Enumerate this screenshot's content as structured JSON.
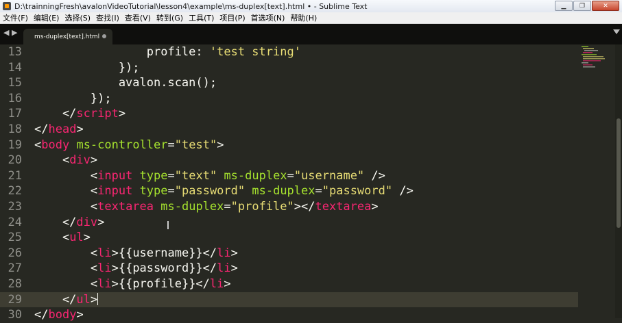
{
  "window": {
    "title": "D:\\trainningFresh\\avalonVideoTutorial\\lesson4\\example\\ms-duplex[text].html • - Sublime Text",
    "minimize_glyph": "▁",
    "maximize_glyph": "❐",
    "close_glyph": "✕"
  },
  "menu": [
    "文件(F)",
    "编辑(E)",
    "选择(S)",
    "查找(I)",
    "查看(V)",
    "转到(G)",
    "工具(T)",
    "项目(P)",
    "首选项(N)",
    "帮助(H)"
  ],
  "tabs": {
    "prev_arrow": "◀",
    "next_arrow": "▶",
    "active": {
      "label": "ms-duplex[text].html",
      "modified": true
    }
  },
  "editor": {
    "theme_colors": {
      "background": "#272822",
      "tag": "#f92672",
      "attribute": "#a6e22e",
      "string": "#e6db74",
      "text": "#f8f8f2",
      "line_number": "#90908a",
      "current_line": "#3e3d32"
    },
    "current_line": 29,
    "lines": [
      {
        "num": "13",
        "tokens": [
          {
            "c": "p",
            "t": "                profile: "
          },
          {
            "c": "s",
            "t": "'test string'"
          }
        ]
      },
      {
        "num": "14",
        "tokens": [
          {
            "c": "p",
            "t": "            });"
          }
        ]
      },
      {
        "num": "15",
        "tokens": [
          {
            "c": "p",
            "t": "            avalon.scan();"
          }
        ]
      },
      {
        "num": "16",
        "tokens": [
          {
            "c": "p",
            "t": "        });"
          }
        ]
      },
      {
        "num": "17",
        "tokens": [
          {
            "c": "p",
            "t": "    </"
          },
          {
            "c": "t",
            "t": "script"
          },
          {
            "c": "p",
            "t": ">"
          }
        ]
      },
      {
        "num": "18",
        "tokens": [
          {
            "c": "p",
            "t": "</"
          },
          {
            "c": "t",
            "t": "head"
          },
          {
            "c": "p",
            "t": ">"
          }
        ]
      },
      {
        "num": "19",
        "tokens": [
          {
            "c": "p",
            "t": "<"
          },
          {
            "c": "t",
            "t": "body"
          },
          {
            "c": "p",
            "t": " "
          },
          {
            "c": "a",
            "t": "ms-controller"
          },
          {
            "c": "p",
            "t": "="
          },
          {
            "c": "s",
            "t": "\"test\""
          },
          {
            "c": "p",
            "t": ">"
          }
        ]
      },
      {
        "num": "20",
        "tokens": [
          {
            "c": "p",
            "t": "    <"
          },
          {
            "c": "t",
            "t": "div"
          },
          {
            "c": "p",
            "t": ">"
          }
        ]
      },
      {
        "num": "21",
        "tokens": [
          {
            "c": "p",
            "t": "        <"
          },
          {
            "c": "t",
            "t": "input"
          },
          {
            "c": "p",
            "t": " "
          },
          {
            "c": "a",
            "t": "type"
          },
          {
            "c": "p",
            "t": "="
          },
          {
            "c": "s",
            "t": "\"text\""
          },
          {
            "c": "p",
            "t": " "
          },
          {
            "c": "a",
            "t": "ms-duplex"
          },
          {
            "c": "p",
            "t": "="
          },
          {
            "c": "s",
            "t": "\"username\""
          },
          {
            "c": "p",
            "t": " />"
          }
        ]
      },
      {
        "num": "22",
        "tokens": [
          {
            "c": "p",
            "t": "        <"
          },
          {
            "c": "t",
            "t": "input"
          },
          {
            "c": "p",
            "t": " "
          },
          {
            "c": "a",
            "t": "type"
          },
          {
            "c": "p",
            "t": "="
          },
          {
            "c": "s",
            "t": "\"password\""
          },
          {
            "c": "p",
            "t": " "
          },
          {
            "c": "a",
            "t": "ms-duplex"
          },
          {
            "c": "p",
            "t": "="
          },
          {
            "c": "s",
            "t": "\"password\""
          },
          {
            "c": "p",
            "t": " />"
          }
        ]
      },
      {
        "num": "23",
        "tokens": [
          {
            "c": "p",
            "t": "        <"
          },
          {
            "c": "t",
            "t": "textarea"
          },
          {
            "c": "p",
            "t": " "
          },
          {
            "c": "a",
            "t": "ms-duplex"
          },
          {
            "c": "p",
            "t": "="
          },
          {
            "c": "s",
            "t": "\"profile\""
          },
          {
            "c": "p",
            "t": "></"
          },
          {
            "c": "t",
            "t": "textarea"
          },
          {
            "c": "p",
            "t": ">"
          }
        ]
      },
      {
        "num": "24",
        "tokens": [
          {
            "c": "p",
            "t": "    </"
          },
          {
            "c": "t",
            "t": "div"
          },
          {
            "c": "p",
            "t": ">"
          }
        ]
      },
      {
        "num": "25",
        "tokens": [
          {
            "c": "p",
            "t": "    <"
          },
          {
            "c": "t",
            "t": "ul"
          },
          {
            "c": "p",
            "t": ">"
          }
        ]
      },
      {
        "num": "26",
        "tokens": [
          {
            "c": "p",
            "t": "        <"
          },
          {
            "c": "t",
            "t": "li"
          },
          {
            "c": "p",
            "t": ">{{username}}</"
          },
          {
            "c": "t",
            "t": "li"
          },
          {
            "c": "p",
            "t": ">"
          }
        ]
      },
      {
        "num": "27",
        "tokens": [
          {
            "c": "p",
            "t": "        <"
          },
          {
            "c": "t",
            "t": "li"
          },
          {
            "c": "p",
            "t": ">{{password}}</"
          },
          {
            "c": "t",
            "t": "li"
          },
          {
            "c": "p",
            "t": ">"
          }
        ]
      },
      {
        "num": "28",
        "tokens": [
          {
            "c": "p",
            "t": "        <"
          },
          {
            "c": "t",
            "t": "li"
          },
          {
            "c": "p",
            "t": ">{{profile}}</"
          },
          {
            "c": "t",
            "t": "li"
          },
          {
            "c": "p",
            "t": ">"
          }
        ]
      },
      {
        "num": "29",
        "tokens": [
          {
            "c": "p",
            "t": "    </"
          },
          {
            "c": "t",
            "t": "ul"
          },
          {
            "c": "p",
            "t": ">"
          }
        ]
      },
      {
        "num": "30",
        "tokens": [
          {
            "c": "p",
            "t": "</"
          },
          {
            "c": "t",
            "t": "body"
          },
          {
            "c": "p",
            "t": ">"
          }
        ]
      }
    ]
  }
}
